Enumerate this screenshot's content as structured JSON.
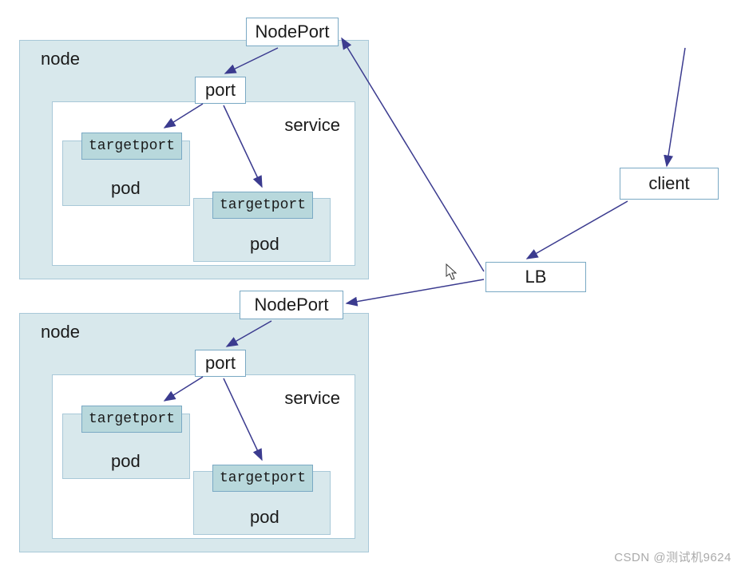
{
  "labels": {
    "nodeport": "NodePort",
    "node": "node",
    "port": "port",
    "service": "service",
    "pod": "pod",
    "targetport": "targetport",
    "lb": "LB",
    "client": "client"
  },
  "watermark": "CSDN @测试机9624",
  "diagram": {
    "description": "Kubernetes LoadBalancer Service traffic flow",
    "flow": [
      "client -> LB",
      "LB -> NodePort (node 1)",
      "LB -> NodePort (node 2)",
      "NodePort -> port (service)",
      "port -> targetport (pod 1)",
      "port -> targetport (pod 2)"
    ],
    "nodes_count": 2,
    "pods_per_node": 2
  }
}
